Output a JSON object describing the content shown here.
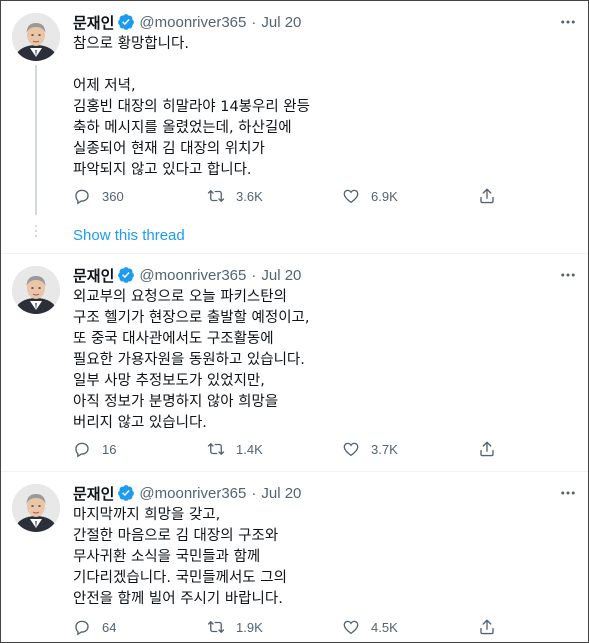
{
  "author": {
    "name": "문재인",
    "handle": "@moonriver365"
  },
  "colors": {
    "verified": "#1d9bf0",
    "link": "#1d9bf0",
    "muted": "#536471"
  },
  "show_thread_label": "Show this thread",
  "tweets": [
    {
      "date": "Jul 20",
      "text": "참으로 황망합니다.\n\n어제 저녁,\n김홍빈 대장의 히말라야 14봉우리 완등\n축하 메시지를 올렸었는데, 하산길에\n실종되어 현재 김 대장의 위치가\n파악되지 않고 있다고 합니다.",
      "replies": "360",
      "retweets": "3.6K",
      "likes": "6.9K"
    },
    {
      "date": "Jul 20",
      "text": "외교부의 요청으로 오늘 파키스탄의\n구조 헬기가 현장으로 출발할 예정이고,\n또 중국 대사관에서도 구조활동에\n필요한 가용자원을 동원하고 있습니다.\n일부 사망 추정보도가 있었지만,\n아직 정보가 분명하지 않아 희망을\n버리지 않고 있습니다.",
      "replies": "16",
      "retweets": "1.4K",
      "likes": "3.7K"
    },
    {
      "date": "Jul 20",
      "text": "마지막까지 희망을 갖고,\n간절한 마음으로 김 대장의 구조와\n무사귀환 소식을 국민들과 함께\n기다리겠습니다. 국민들께서도 그의\n안전을 함께 빌어 주시기 바랍니다.",
      "replies": "64",
      "retweets": "1.9K",
      "likes": "4.5K"
    }
  ],
  "icons": {
    "reply": "reply-icon",
    "retweet": "retweet-icon",
    "like": "heart-icon",
    "share": "share-icon",
    "more": "more-icon",
    "verified": "verified-badge-icon"
  }
}
